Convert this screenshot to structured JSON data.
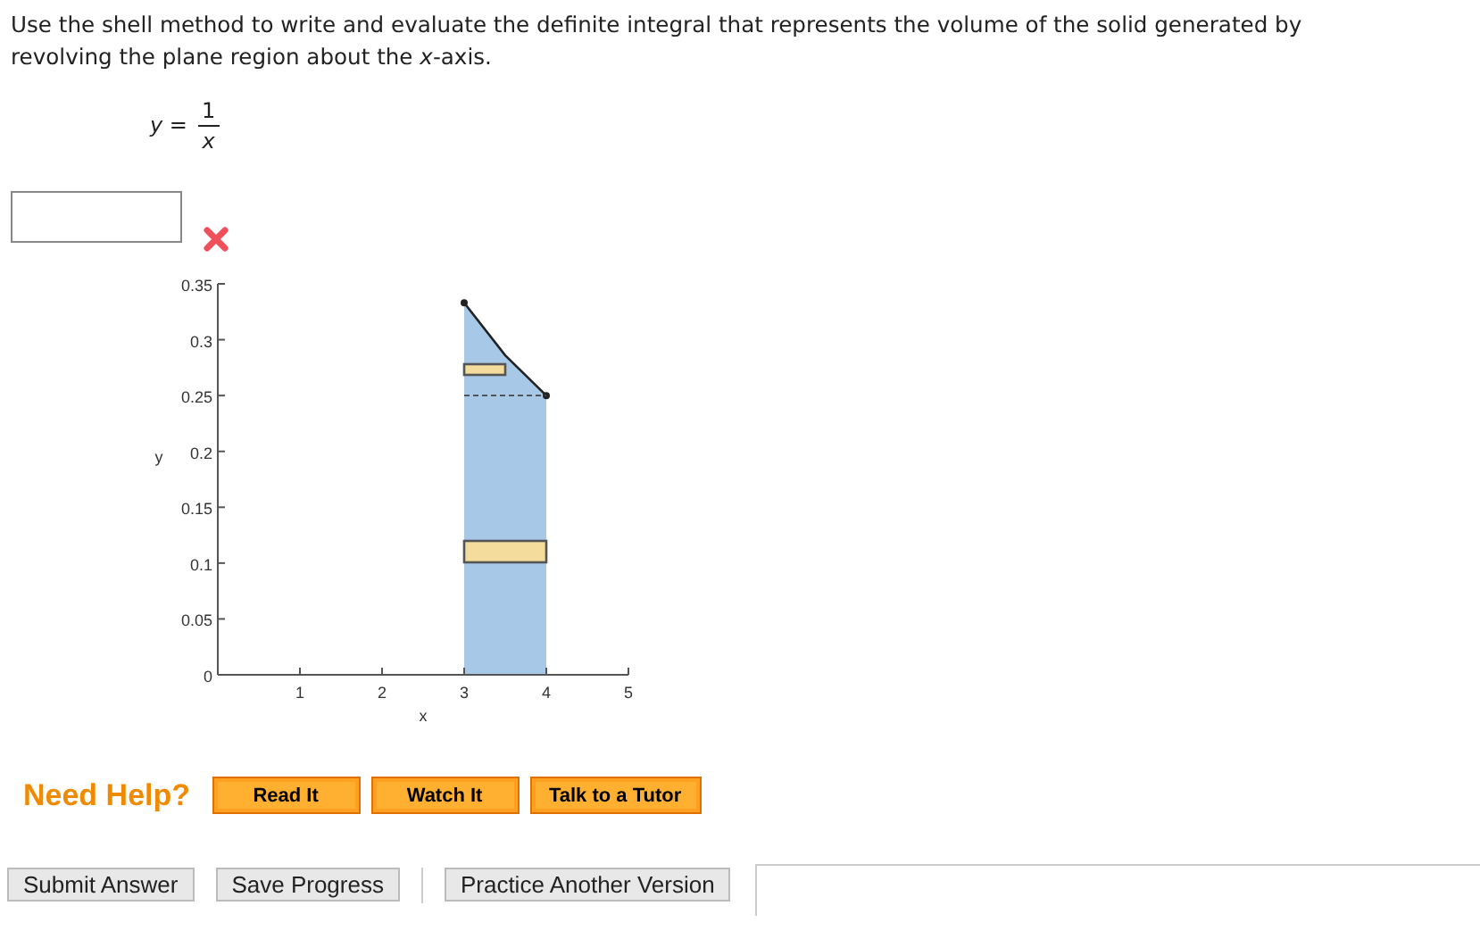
{
  "question": "Use the shell method to write and evaluate the definite integral that represents the volume of the solid generated by revolving the plane region about the *x*-axis.",
  "equation": {
    "lhs": "*y* =",
    "numerator": "1",
    "denominator": "x"
  },
  "answer": {
    "correct": false
  },
  "graph": {
    "chart_data": {
      "type": "area",
      "xlabel": "x",
      "ylabel": "y",
      "x": [
        3,
        3.5,
        4
      ],
      "series": [
        {
          "color": "#a8c8e8",
          "values": [
            0.333,
            0.286,
            0.25
          ]
        }
      ],
      "xlim": [
        0,
        5
      ],
      "ylim": [
        0,
        0.35
      ],
      "xticks": [
        1,
        2,
        3,
        4,
        5
      ],
      "yticks": [
        0,
        0.05,
        0.1,
        0.15,
        0.2,
        0.25,
        0.3,
        0.35
      ]
    }
  },
  "help": {
    "label": "Need Help?",
    "buttons": [
      "Read It",
      "Watch It",
      "Talk to a Tutor"
    ]
  },
  "actions": {
    "primary": [
      "Submit Answer",
      "Save Progress"
    ],
    "secondary": [
      "Practice Another Version"
    ]
  }
}
